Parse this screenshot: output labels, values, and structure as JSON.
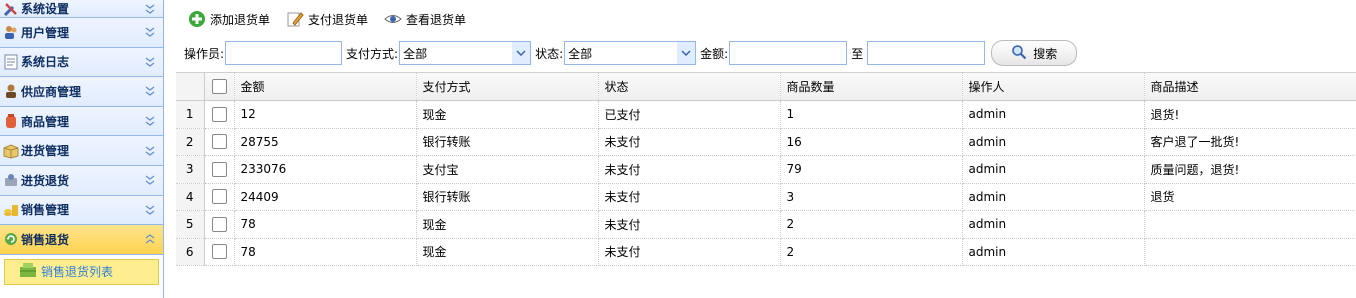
{
  "sidebar": {
    "items": [
      {
        "label": "系统设置",
        "icon": "tools-icon"
      },
      {
        "label": "用户管理",
        "icon": "users-icon"
      },
      {
        "label": "系统日志",
        "icon": "log-icon"
      },
      {
        "label": "供应商管理",
        "icon": "supplier-icon"
      },
      {
        "label": "商品管理",
        "icon": "goods-icon"
      },
      {
        "label": "进货管理",
        "icon": "purchase-icon"
      },
      {
        "label": "进货退货",
        "icon": "purchase-return-icon"
      },
      {
        "label": "销售管理",
        "icon": "sales-icon"
      },
      {
        "label": "销售退货",
        "icon": "sales-return-icon"
      }
    ],
    "sub_item": {
      "label": "销售退货列表",
      "icon": "return-list-icon"
    }
  },
  "toolbar": {
    "add_label": "添加退货单",
    "pay_label": "支付退货单",
    "view_label": "查看退货单"
  },
  "filters": {
    "operator_label": "操作员:",
    "operator_value": "",
    "payment_label": "支付方式:",
    "payment_value": "全部",
    "status_label": "状态:",
    "status_value": "全部",
    "amount_label": "金额:",
    "amount_from": "",
    "to_label": "至",
    "amount_to": "",
    "search_label": "搜索"
  },
  "grid": {
    "columns": [
      "金额",
      "支付方式",
      "状态",
      "商品数量",
      "操作人",
      "商品描述"
    ],
    "rows": [
      {
        "n": "1",
        "amount": "12",
        "method": "现金",
        "status": "已支付",
        "qty": "1",
        "operator": "admin",
        "desc": "退货!"
      },
      {
        "n": "2",
        "amount": "28755",
        "method": "银行转账",
        "status": "未支付",
        "qty": "16",
        "operator": "admin",
        "desc": "客户退了一批货!"
      },
      {
        "n": "3",
        "amount": "233076",
        "method": "支付宝",
        "status": "未支付",
        "qty": "79",
        "operator": "admin",
        "desc": "质量问题，退货!"
      },
      {
        "n": "4",
        "amount": "24409",
        "method": "银行转账",
        "status": "未支付",
        "qty": "3",
        "operator": "admin",
        "desc": "退货"
      },
      {
        "n": "5",
        "amount": "78",
        "method": "现金",
        "status": "未支付",
        "qty": "2",
        "operator": "admin",
        "desc": ""
      },
      {
        "n": "6",
        "amount": "78",
        "method": "现金",
        "status": "未支付",
        "qty": "2",
        "operator": "admin",
        "desc": ""
      }
    ]
  },
  "colors": {
    "accent": "#95b8e7",
    "active": "#ffd34e",
    "link": "#2f7fd8"
  }
}
